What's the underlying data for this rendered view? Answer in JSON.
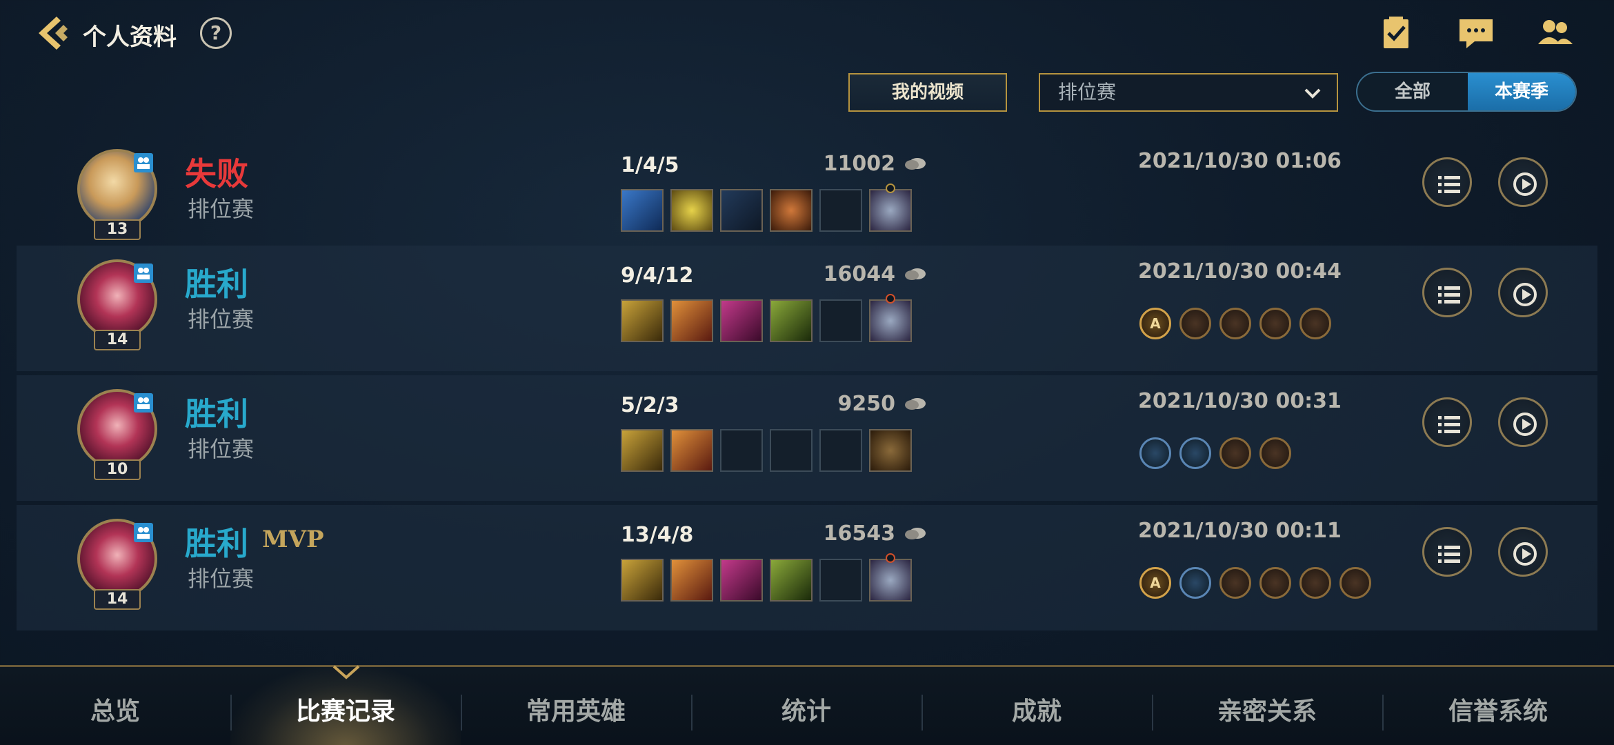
{
  "header": {
    "title": "个人资料",
    "help_label": "?"
  },
  "filters": {
    "video_button": "我的视频",
    "mode_selected": "排位赛",
    "season_options": [
      "全部",
      "本赛季"
    ],
    "season_selected": "本赛季"
  },
  "matches": [
    {
      "result": "失败",
      "result_type": "lose",
      "mvp": "",
      "mode": "排位赛",
      "level": "13",
      "kda": "1/4/5",
      "gold": "11002",
      "date": "2021/10/30 01:06",
      "medals": []
    },
    {
      "result": "胜利",
      "result_type": "win",
      "mvp": "",
      "mode": "排位赛",
      "level": "14",
      "kda": "9/4/12",
      "gold": "16044",
      "date": "2021/10/30 00:44",
      "medals": [
        "A",
        "",
        "",
        "",
        ""
      ]
    },
    {
      "result": "胜利",
      "result_type": "win",
      "mvp": "",
      "mode": "排位赛",
      "level": "10",
      "kda": "5/2/3",
      "gold": "9250",
      "date": "2021/10/30 00:31",
      "medals": [
        "",
        "",
        "",
        ""
      ]
    },
    {
      "result": "胜利",
      "result_type": "win",
      "mvp": "MVP",
      "mode": "排位赛",
      "level": "14",
      "kda": "13/4/8",
      "gold": "16543",
      "date": "2021/10/30 00:11",
      "medals": [
        "A",
        "",
        "",
        "",
        "",
        ""
      ]
    }
  ],
  "bottom_nav": {
    "items": [
      "总览",
      "比赛记录",
      "常用英雄",
      "统计",
      "成就",
      "亲密关系",
      "信誉系统"
    ],
    "active": "比赛记录"
  },
  "colors": {
    "win": "#28a9cc",
    "lose": "#e8393a",
    "gold_accent": "#b6943f",
    "active_toggle": "#2a8fd0"
  }
}
